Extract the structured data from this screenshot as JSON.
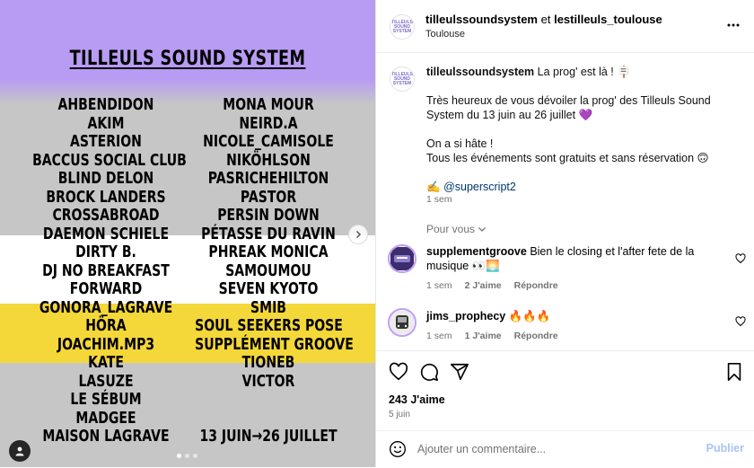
{
  "poster": {
    "title": "TILLEULS SOUND SYSTEM",
    "left_column": [
      "AHBENDIDON",
      "AKIM",
      "ASTERION",
      "BACCUS SOCIAL CLUB",
      "BLIND DELON",
      "BROCK LANDERS",
      "CROSSABROAD",
      "DAEMON SCHIELE",
      "DIRTY B.",
      "DJ NO BREAKFAST",
      "FORWARD",
      "GONORA_LAGRAVE",
      "HÖRA",
      "JOACHIM.MP3",
      "KATE",
      "LASUZE",
      "LE SÉBUM",
      "MADGEE",
      "MAISON LAGRAVE"
    ],
    "right_column": [
      "MONA MOUR",
      "NEIRD.A",
      "NICOLE_CAMISOLE",
      "NIKÖHLSON",
      "PASRICHEHILTON",
      "PASTOR",
      "PERSIN DOWN",
      "PÉTASSE DU RAVIN",
      "PHREAK MONICA",
      "SAMOUMOU",
      "SEVEN KYOTO",
      "SMIB",
      "SOUL SEEKERS POSE",
      "SUPPLÉMENT GROOVE",
      "TIONEB",
      "VICTOR"
    ],
    "dates": "13 JUIN→26 JUILLET",
    "colors": {
      "purple": "#b89bf2",
      "grey": "#c6c6c6",
      "yellow": "#f4d739"
    }
  },
  "header": {
    "user1": "tilleulssoundsystem",
    "joiner": "et",
    "user2": "lestilleuls_toulouse",
    "location": "Toulouse",
    "avatar_text": "TILLEULS SOUND SYSTEM"
  },
  "caption": {
    "user": "tilleulssoundsystem",
    "line1": "La prog' est là ! 🪧",
    "para2": "Très heureux de vous dévoiler la prog' des Tilleuls Sound System du 13 juin au 26 juillet 💜",
    "para3a": "On a si hâte !",
    "para3b": "Tous les événements sont gratuits et sans réservation 🙃",
    "credit_emoji": "✍️",
    "mention": "@superscript2",
    "time": "1 sem"
  },
  "pour_vous": "Pour vous",
  "comments": [
    {
      "user": "supplementgroove",
      "text": "Bien le closing et l'after fete de la musique 👀🌅",
      "time": "1 sem",
      "likes": "2 J'aime",
      "reply": "Répondre"
    },
    {
      "user": "jims_prophecy",
      "text": "🔥🔥🔥",
      "time": "1 sem",
      "likes": "1 J'aime",
      "reply": "Répondre"
    }
  ],
  "likes": "243 J'aime",
  "date": "5 juin",
  "comment_placeholder": "Ajouter un commentaire...",
  "publish": "Publier",
  "icons": [
    "more-icon",
    "heart-icon",
    "comment-icon",
    "share-icon",
    "bookmark-icon",
    "emoji-icon",
    "chevron-right-icon",
    "chevron-down-icon",
    "user-tag-icon"
  ]
}
